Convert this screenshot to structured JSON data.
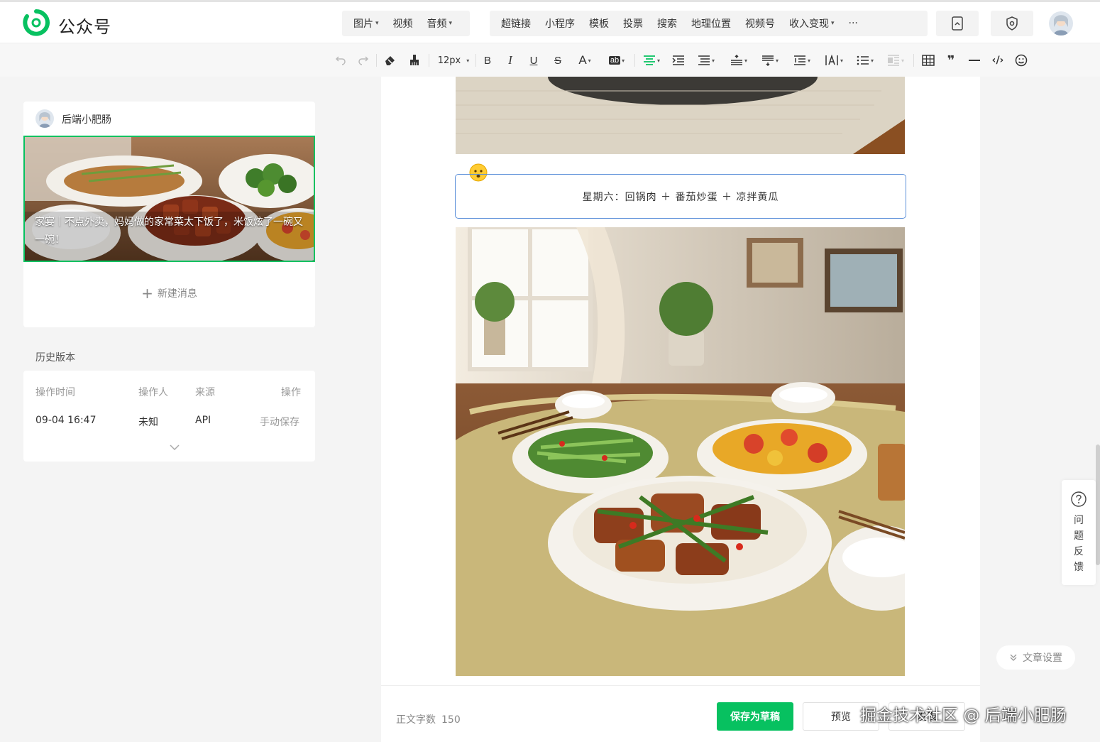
{
  "header": {
    "brand": "公众号",
    "menu_group1": [
      {
        "label": "图片",
        "caret": "▾"
      },
      {
        "label": "视频",
        "caret": ""
      },
      {
        "label": "音频",
        "caret": "▾"
      }
    ],
    "menu_group2": [
      {
        "label": "超链接",
        "caret": ""
      },
      {
        "label": "小程序",
        "caret": ""
      },
      {
        "label": "模板",
        "caret": ""
      },
      {
        "label": "投票",
        "caret": ""
      },
      {
        "label": "搜索",
        "caret": ""
      },
      {
        "label": "地理位置",
        "caret": ""
      },
      {
        "label": "视频号",
        "caret": ""
      },
      {
        "label": "收入变现",
        "caret": "▾"
      },
      {
        "label": "···",
        "caret": ""
      }
    ]
  },
  "toolbar": {
    "font_size": "12px",
    "bold": "B",
    "italic": "I",
    "underline": "U",
    "strike": "S",
    "font_color": "A",
    "bg_color": "ab",
    "quote": "❞",
    "code": "‹/›",
    "caret": "▾"
  },
  "left": {
    "account_name": "后端小肥肠",
    "cover_title": "家宴｜不点外卖，妈妈做的家常菜太下饭了，米饭炫了一碗又一碗！",
    "new_message": "新建消息",
    "new_message_plus": "+",
    "history_label": "历史版本",
    "history": {
      "headers": {
        "time": "操作时间",
        "operator": "操作人",
        "source": "来源",
        "action": "操作"
      },
      "row": {
        "time": "09-04 16:47",
        "operator": "未知",
        "source": "API",
        "action": "手动保存"
      }
    }
  },
  "editor": {
    "day_text": "星期六：回锅肉 ＋ 番茄炒蛋 ＋ 凉拌黄瓜"
  },
  "footer": {
    "wordcount_label": "正文字数",
    "wordcount_value": "150",
    "save_draft": "保存为草稿",
    "preview": "预览",
    "publish": "发表",
    "watermark": "掘金技术社区 @ 后端小肥肠"
  },
  "side": {
    "feedback": "问题反馈",
    "settings": "文章设置"
  },
  "colors": {
    "accent": "#07c160",
    "day_box_border": "#5b8fd9"
  }
}
